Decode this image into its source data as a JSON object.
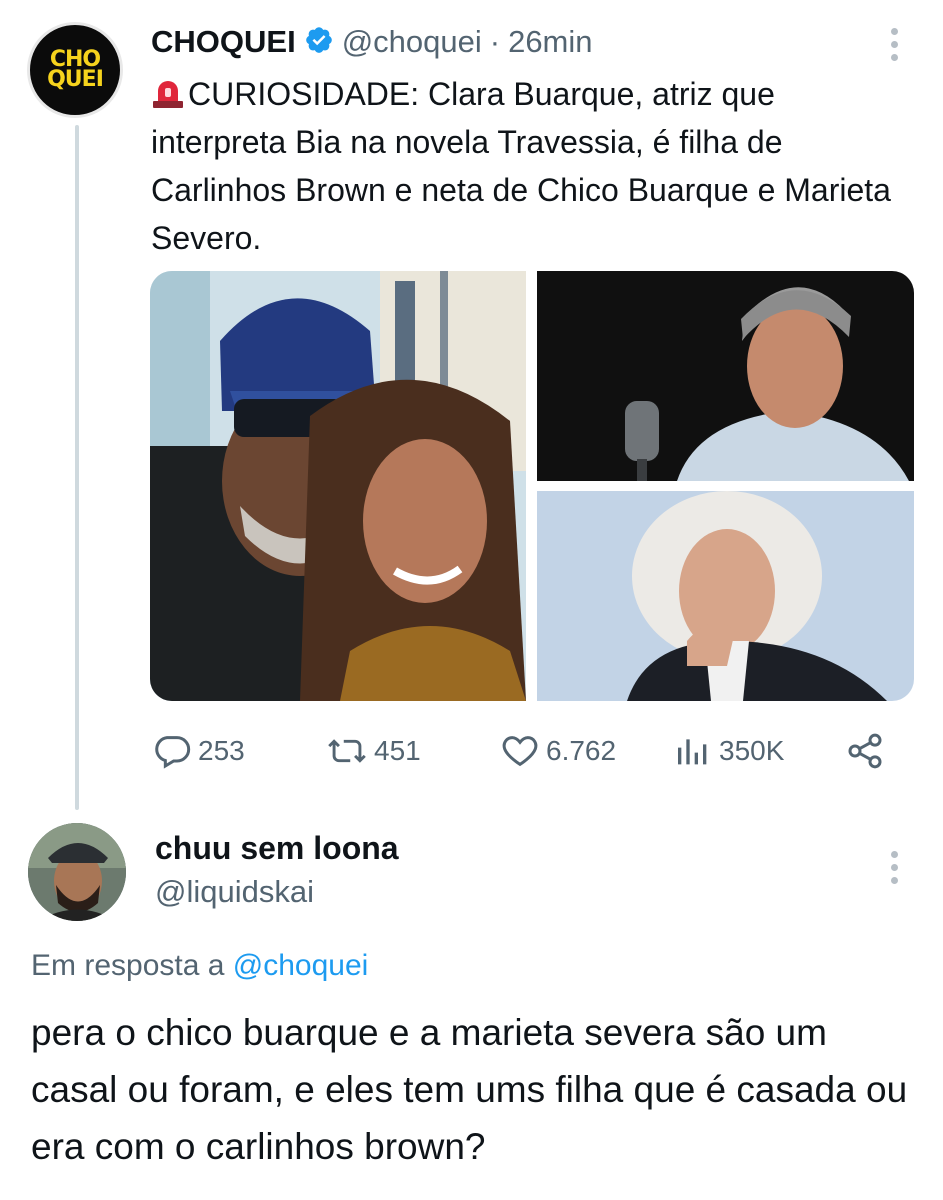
{
  "tweet": {
    "avatar_text_line1": "CHO",
    "avatar_text_line2": "QUEI",
    "author_name": "CHOQUEI",
    "handle": "@choquei",
    "separator": "·",
    "time": "26min",
    "text": "CURIOSIDADE: Clara Buarque, atriz que interpreta Bia na novela Travessia, é filha de Carlinhos Brown e neta de Chico Buarque e Marieta Severo.",
    "emoji_icon": "rotating-light-icon",
    "media": [
      {
        "name": "photo-selfie-pair"
      },
      {
        "name": "photo-man-microphone"
      },
      {
        "name": "photo-woman-portrait"
      }
    ],
    "stats": {
      "replies": "253",
      "retweets": "451",
      "likes": "6.762",
      "views": "350K"
    }
  },
  "reply": {
    "author_name": "chuu sem loona",
    "handle": "@liquidskai",
    "in_reply_to_prefix": "Em resposta a",
    "in_reply_to_mention": "@choquei",
    "text": "pera o chico buarque e a marieta severa são um casal ou foram, e eles tem ums filha que é casada ou era com o carlinhos brown?"
  },
  "colors": {
    "text": "#0f1419",
    "secondary": "#536471",
    "link": "#1d9bf0",
    "verified": "#1d9bf0",
    "brand_yellow": "#f6d31d"
  }
}
